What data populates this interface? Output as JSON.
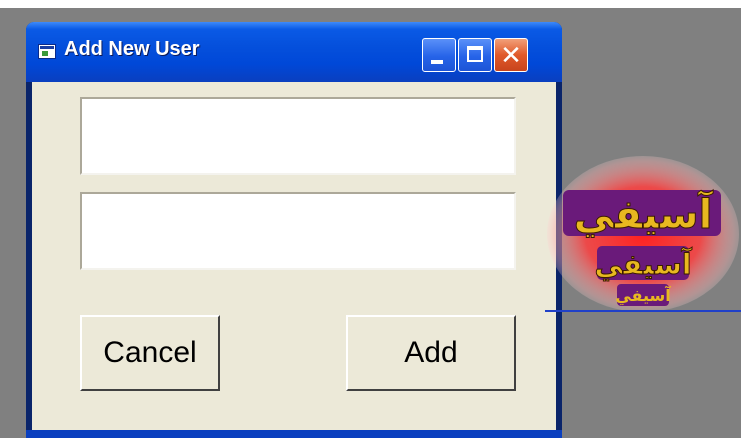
{
  "window": {
    "title": "Add New User",
    "title_icon": "form-window-icon"
  },
  "titlebar_buttons": {
    "minimize": "minimize-icon",
    "maximize": "maximize-icon",
    "close": "close-icon"
  },
  "form": {
    "field1_value": "",
    "field2_value": "",
    "cancel_label": "Cancel",
    "add_label": "Add"
  },
  "logo": {
    "text": "آسيفي",
    "colors": {
      "glow": "#ff3030",
      "plate": "#6a1a7a",
      "gold": "#e8b820"
    }
  },
  "theme": {
    "titlebar": "#0550dc",
    "client": "#ece9d8",
    "background": "#808080",
    "close_button": "#e0592a"
  }
}
